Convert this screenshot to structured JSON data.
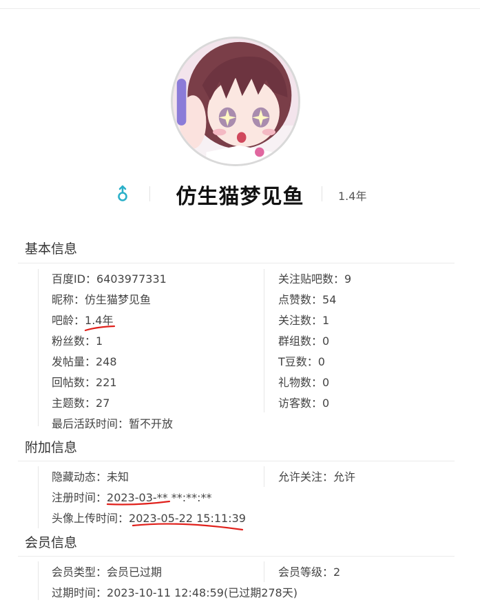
{
  "profile": {
    "username": "仿生猫梦见鱼",
    "age_badge": "1.4年",
    "gender_icon": "male-icon"
  },
  "sections": {
    "basic": {
      "title": "基本信息",
      "left": [
        {
          "label": "百度ID：",
          "value": "6403977331"
        },
        {
          "label": "昵称：",
          "value": "仿生猫梦见鱼"
        },
        {
          "label": "吧龄：",
          "value": "1.4年"
        },
        {
          "label": "粉丝数：",
          "value": "1"
        },
        {
          "label": "发帖量：",
          "value": "248"
        },
        {
          "label": "回帖数：",
          "value": "221"
        },
        {
          "label": "主题数：",
          "value": "27"
        },
        {
          "label": "最后活跃时间：",
          "value": "暂不开放"
        }
      ],
      "right": [
        {
          "label": "关注贴吧数：",
          "value": "9"
        },
        {
          "label": "点赞数：",
          "value": "54"
        },
        {
          "label": "关注数：",
          "value": "1"
        },
        {
          "label": "群组数：",
          "value": "0"
        },
        {
          "label": "T豆数：",
          "value": "0"
        },
        {
          "label": "礼物数：",
          "value": "0"
        },
        {
          "label": "访客数：",
          "value": "0"
        }
      ]
    },
    "extra": {
      "title": "附加信息",
      "left": [
        {
          "label": "隐藏动态：",
          "value": "未知"
        },
        {
          "label": "注册时间：",
          "value": "2023-03-** **:**:**"
        },
        {
          "label": "头像上传时间：",
          "value": "2023-05-22 15:11:39"
        }
      ],
      "right": [
        {
          "label": "允许关注：",
          "value": "允许"
        }
      ]
    },
    "vip": {
      "title": "会员信息",
      "left": [
        {
          "label": "会员类型：",
          "value": "会员已过期"
        },
        {
          "label": "过期时间：",
          "value": "2023-10-11 12:48:59(已过期278天)"
        }
      ],
      "right": [
        {
          "label": "会员等级：",
          "value": "2"
        }
      ]
    }
  },
  "colors": {
    "annotation_red": "#e0201b",
    "gender_blue": "#2bb0c9"
  }
}
